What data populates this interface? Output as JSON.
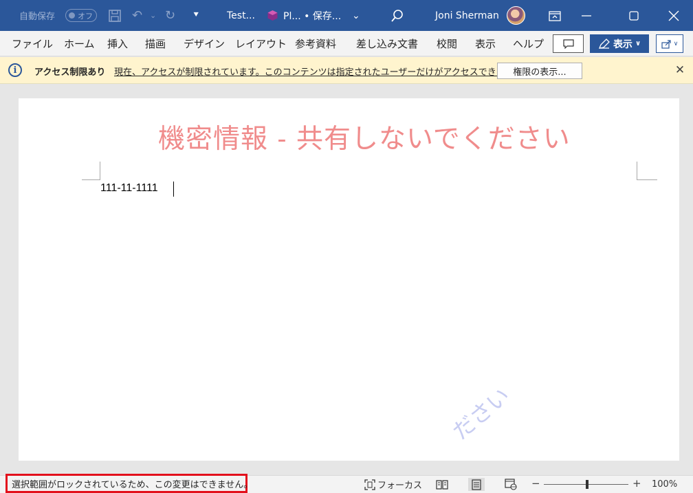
{
  "titlebar": {
    "autosave_label": "自動保存",
    "autosave_state": "オフ",
    "doc_title": "Test...",
    "sensitivity_label": "Pl... • 保存...",
    "user_name": "Joni Sherman",
    "colors": {
      "background": "#2b579a"
    }
  },
  "ribbon": {
    "tabs": [
      "ファイル",
      "ホーム",
      "挿入",
      "描画",
      "デザイン",
      "レイアウト",
      "参考資料",
      "差し込み文書",
      "校閲",
      "表示",
      "ヘルプ"
    ],
    "view_button_label": "表示"
  },
  "infobar": {
    "title": "アクセス制限あり",
    "message": "現在、アクセスが制限されています。このコンテンツは指定されたユーザーだけがアクセスできます。",
    "permission_button": "権限の表示...",
    "background": "#fff4ce"
  },
  "document": {
    "watermark_header": "機密情報 - 共有しないでください",
    "body_text": "111-11-1111",
    "diagonal_watermark_fragment": "ださい"
  },
  "statusbar": {
    "message": "選択範囲がロックされているため、この変更はできません。",
    "focus_label": "フォーカス",
    "zoom_level": "100%",
    "highlight_color": "#e3101c"
  }
}
